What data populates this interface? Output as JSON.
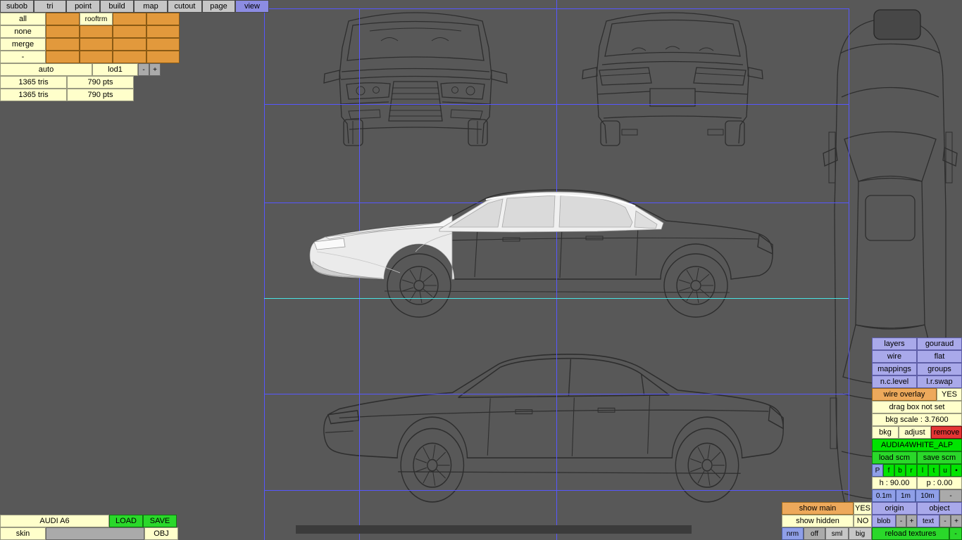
{
  "menu": {
    "tabs": [
      "subob",
      "tri",
      "point",
      "build",
      "map",
      "cutout",
      "page",
      "view"
    ]
  },
  "trim_panel": {
    "select_buttons": [
      "all",
      "none",
      "merge",
      "-"
    ],
    "active_trim": "rooftrm"
  },
  "lod_bar": {
    "auto_label": "auto",
    "lod_label": "lod1",
    "minus": "-",
    "plus": "+"
  },
  "stats": {
    "row1": {
      "tris": "1365 tris",
      "pts": "790 pts"
    },
    "row2": {
      "tris": "1365 tris",
      "pts": "790 pts"
    }
  },
  "file_bar": {
    "model_name": "AUDI A6",
    "load": "LOAD",
    "save": "SAVE",
    "skin": "skin",
    "obj": "OBJ"
  },
  "display_panel": {
    "layers": "layers",
    "gouraud": "gouraud",
    "wire": "wire",
    "flat": "flat",
    "mappings": "mappings",
    "groups": "groups",
    "nc_level": "n.c.level",
    "lr_swap": "l.r.swap",
    "wire_overlay": "wire overlay",
    "wire_overlay_value": "YES",
    "drag_box": "drag box not set",
    "bkg_scale": "bkg scale : 3.7600",
    "bkg": "bkg",
    "adjust": "adjust",
    "remove": "remove",
    "texture_name": "AUDIA4WHITE_ALP",
    "load_scm": "load scm",
    "save_scm": "save scm",
    "view_keys": [
      "P",
      "f",
      "b",
      "r",
      "l",
      "t",
      "u",
      "•"
    ],
    "heading": "h : 90.00",
    "pitch": "p : 0.00",
    "grid_units": [
      "0.1m",
      "1m",
      "10m",
      "-"
    ]
  },
  "status_panel": {
    "show_main": "show main",
    "show_main_value": "YES",
    "show_hidden": "show hidden",
    "show_hidden_value": "NO",
    "origin": "origin",
    "object": "object",
    "blob": "blob",
    "blob_minus": "-",
    "blob_plus": "+",
    "text": "text",
    "text_minus": "-",
    "text_plus": "+",
    "nrm": "nrm",
    "off": "off",
    "sml": "sml",
    "big": "big",
    "reload_textures": "reload textures",
    "reload_minus": "-"
  },
  "colors": {
    "viewport_bg": "#585858",
    "grid_blue": "#5757ff",
    "grid_cyan": "#49e3e3",
    "accent_green": "#00e400",
    "accent_orange": "#e2993c",
    "accent_lavender": "#a9a9ea"
  }
}
